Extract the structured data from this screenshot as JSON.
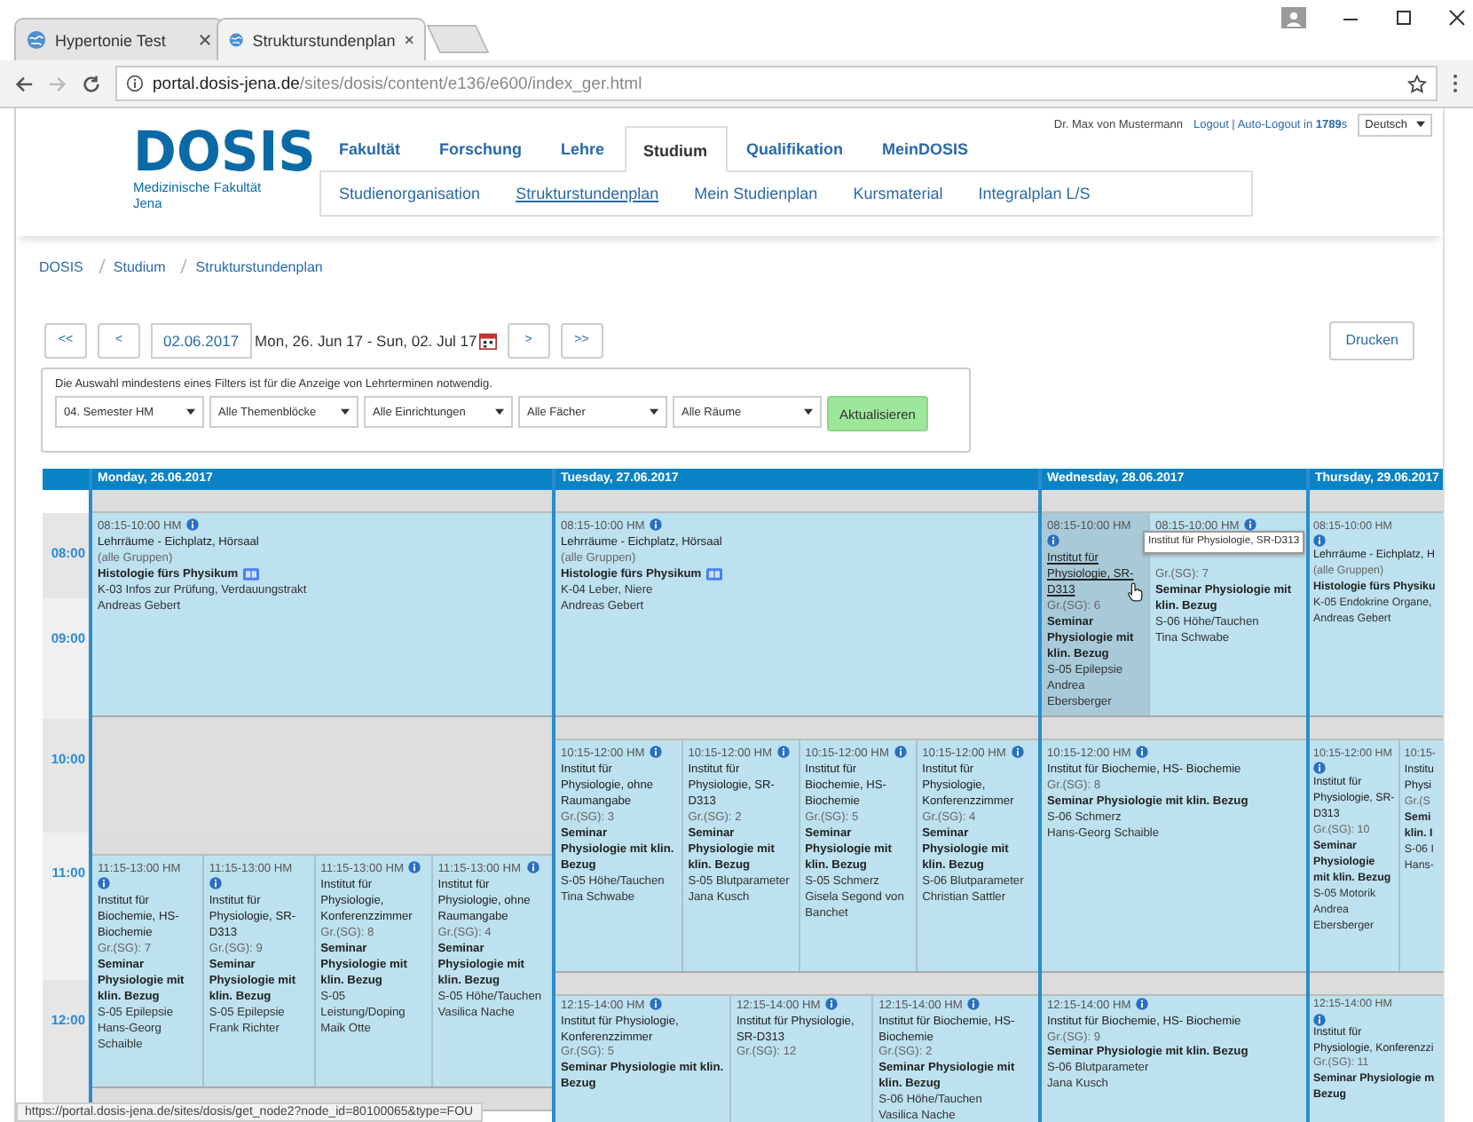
{
  "browser": {
    "tabs": [
      {
        "title": "Hypertonie Test",
        "selected": false
      },
      {
        "title": "Strukturstundenplan",
        "selected": true
      }
    ],
    "address": {
      "domain": "portal.dosis-jena.de",
      "path": "/sites/dosis/content/e136/e600/index_ger.html"
    }
  },
  "site": {
    "logo": "DOSIS",
    "logo_sub": [
      "Medizinische Fakultät",
      "Jena"
    ],
    "nav": [
      {
        "label": "Fakultät",
        "selected": false
      },
      {
        "label": "Forschung",
        "selected": false
      },
      {
        "label": "Lehre",
        "selected": false
      },
      {
        "label": "Studium",
        "selected": true
      },
      {
        "label": "Qualifikation",
        "selected": false
      },
      {
        "label": "MeinDOSIS",
        "selected": false
      }
    ],
    "subnav": [
      {
        "label": "Studienorganisation",
        "selected": false
      },
      {
        "label": "Strukturstundenplan",
        "selected": true
      },
      {
        "label": "Mein Studienplan",
        "selected": false
      },
      {
        "label": "Kursmaterial",
        "selected": false
      },
      {
        "label": "Integralplan L/S",
        "selected": false
      }
    ],
    "user": "Dr. Max von Mustermann",
    "logout": "Logout | Auto-Logout in **1789**s",
    "language": "Deutsch"
  },
  "breadcrumb": [
    "DOSIS",
    "Studium",
    "Strukturstundenplan"
  ],
  "toolbar": {
    "first": "<<",
    "prev": "<",
    "date": "02.06.2017",
    "range": "Mon, 26. Jun 17 - Sun, 02. Jul 17",
    "next": ">",
    "last": ">>",
    "print": "Drucken"
  },
  "filters": {
    "note": "Die Auswahl mindestens eines Filters ist für die Anzeige von Lehrterminen notwendig.",
    "selects": [
      "04. Semester HM",
      "Alle Themenblöcke",
      "Alle Einrichtungen",
      "Alle Fächer",
      "Alle Räume"
    ],
    "submit": "Aktualisieren"
  },
  "hours": [
    "08:00",
    "09:00",
    "10:00",
    "11:00",
    "12:00"
  ],
  "days": [
    {
      "title": "Monday, 26.06.2017",
      "segments": [
        {
          "kind": "strip"
        },
        {
          "kind": "block",
          "events": [
            {
              "time": "08:15-10:00 HM",
              "info": true,
              "hovered": false,
              "lines": [
                {
                  "kind": "room",
                  "text": "Lehrräume - Eichplatz, Hörsaal"
                },
                {
                  "kind": "group",
                  "text": "(alle Gruppen)"
                },
                {
                  "kind": "title",
                  "text": "Histologie fürs Physikum",
                  "book": true
                },
                {
                  "kind": "topic",
                  "text": "K-03 Infos zur Prüfung, Verdauungstrakt"
                },
                {
                  "kind": "lecturer",
                  "text": "Andreas Gebert"
                }
              ]
            }
          ]
        },
        {
          "kind": "free"
        },
        {
          "kind": "strip"
        },
        {
          "kind": "block",
          "events": [
            {
              "time": "11:15-13:00 HM",
              "info": true,
              "hovered": false,
              "lines": [
                {
                  "kind": "room",
                  "text": "Institut für Biochemie, HS-Biochemie"
                },
                {
                  "kind": "group",
                  "text": "Gr.(SG): 7"
                },
                {
                  "kind": "title",
                  "text": "Seminar Physiologie mit klin. Bezug"
                },
                {
                  "kind": "topic",
                  "text": "S-05 Epilepsie"
                },
                {
                  "kind": "lecturer",
                  "text": "Hans-Georg Schaible"
                }
              ]
            },
            {
              "time": "11:15-13:00 HM",
              "info": true,
              "hovered": false,
              "lines": [
                {
                  "kind": "room",
                  "text": "Institut für Physiologie, SR-D313"
                },
                {
                  "kind": "group",
                  "text": "Gr.(SG): 9"
                },
                {
                  "kind": "title",
                  "text": "Seminar Physiologie mit klin. Bezug"
                },
                {
                  "kind": "topic",
                  "text": "S-05 Epilepsie"
                },
                {
                  "kind": "lecturer",
                  "text": "Frank Richter"
                }
              ]
            },
            {
              "time": "11:15-13:00 HM",
              "info": true,
              "hovered": false,
              "lines": [
                {
                  "kind": "room",
                  "text": "Institut für Physiologie, Konferenzzimmer"
                },
                {
                  "kind": "group",
                  "text": "Gr.(SG): 8"
                },
                {
                  "kind": "title",
                  "text": "Seminar Physiologie mit klin. Bezug"
                },
                {
                  "kind": "topic",
                  "text": "S-05 Leistung/Doping"
                },
                {
                  "kind": "lecturer",
                  "text": "Maik Otte"
                }
              ]
            },
            {
              "time": "11:15-13:00 HM",
              "info": true,
              "hovered": false,
              "lines": [
                {
                  "kind": "room",
                  "text": "Institut für Physiologie, ohne Raumangabe"
                },
                {
                  "kind": "group",
                  "text": "Gr.(SG): 4"
                },
                {
                  "kind": "title",
                  "text": "Seminar Physiologie mit klin. Bezug"
                },
                {
                  "kind": "topic",
                  "text": "S-05 Höhe/Tauchen"
                },
                {
                  "kind": "lecturer",
                  "text": "Vasilica Nache"
                }
              ]
            }
          ]
        },
        {
          "kind": "strip"
        }
      ]
    },
    {
      "title": "Tuesday, 27.06.2017",
      "segments": [
        {
          "kind": "strip"
        },
        {
          "kind": "block",
          "events": [
            {
              "time": "08:15-10:00 HM",
              "info": true,
              "hovered": false,
              "lines": [
                {
                  "kind": "room",
                  "text": "Lehrräume - Eichplatz, Hörsaal"
                },
                {
                  "kind": "group",
                  "text": "(alle Gruppen)"
                },
                {
                  "kind": "title",
                  "text": "Histologie fürs Physikum",
                  "book": true
                },
                {
                  "kind": "topic",
                  "text": "K-04 Leber, Niere"
                },
                {
                  "kind": "lecturer",
                  "text": "Andreas Gebert"
                }
              ]
            }
          ]
        },
        {
          "kind": "strip"
        },
        {
          "kind": "block",
          "events": [
            {
              "time": "10:15-12:00 HM",
              "info": true,
              "hovered": false,
              "lines": [
                {
                  "kind": "room",
                  "text": "Institut für Physiologie, ohne Raumangabe"
                },
                {
                  "kind": "group",
                  "text": "Gr.(SG): 3"
                },
                {
                  "kind": "title",
                  "text": "Seminar Physiologie mit klin. Bezug"
                },
                {
                  "kind": "topic",
                  "text": "S-05 Höhe/Tauchen"
                },
                {
                  "kind": "lecturer",
                  "text": "Tina Schwabe"
                }
              ]
            },
            {
              "time": "10:15-12:00 HM",
              "info": true,
              "hovered": false,
              "lines": [
                {
                  "kind": "room",
                  "text": "Institut für Physiologie, SR-D313"
                },
                {
                  "kind": "group",
                  "text": "Gr.(SG): 2"
                },
                {
                  "kind": "title",
                  "text": "Seminar Physiologie mit klin. Bezug"
                },
                {
                  "kind": "topic",
                  "text": "S-05 Blutparameter"
                },
                {
                  "kind": "lecturer",
                  "text": "Jana Kusch"
                }
              ]
            },
            {
              "time": "10:15-12:00 HM",
              "info": true,
              "hovered": false,
              "lines": [
                {
                  "kind": "room",
                  "text": "Institut für Biochemie, HS-Biochemie"
                },
                {
                  "kind": "group",
                  "text": "Gr.(SG): 5"
                },
                {
                  "kind": "title",
                  "text": "Seminar Physiologie mit klin. Bezug"
                },
                {
                  "kind": "topic",
                  "text": "S-05 Schmerz"
                },
                {
                  "kind": "lecturer",
                  "text": "Gisela Segond von Banchet"
                }
              ]
            },
            {
              "time": "10:15-12:00 HM",
              "info": true,
              "hovered": false,
              "lines": [
                {
                  "kind": "room",
                  "text": "Institut für Physiologie, Konferenzzimmer"
                },
                {
                  "kind": "group",
                  "text": "Gr.(SG): 4"
                },
                {
                  "kind": "title",
                  "text": "Seminar Physiologie mit klin. Bezug"
                },
                {
                  "kind": "topic",
                  "text": "S-06 Blutparameter"
                },
                {
                  "kind": "lecturer",
                  "text": "Christian Sattler"
                }
              ]
            }
          ]
        },
        {
          "kind": "strip"
        },
        {
          "kind": "block",
          "events": [
            {
              "time": "12:15-14:00 HM",
              "info": true,
              "hovered": false,
              "lines": [
                {
                  "kind": "room",
                  "text": "Institut für Physiologie, Konferenzzimmer"
                },
                {
                  "kind": "group",
                  "text": "Gr.(SG): 5"
                },
                {
                  "kind": "title",
                  "text": "Seminar Physiologie mit klin. Bezug"
                }
              ]
            },
            {
              "time": "12:15-14:00 HM",
              "info": true,
              "hovered": false,
              "lines": [
                {
                  "kind": "room",
                  "text": "Institut für Physiologie, SR-D313"
                },
                {
                  "kind": "group",
                  "text": "Gr.(SG): 12"
                }
              ]
            },
            {
              "time": "12:15-14:00 HM",
              "info": true,
              "hovered": false,
              "lines": [
                {
                  "kind": "room",
                  "text": "Institut für Biochemie, HS- Biochemie"
                },
                {
                  "kind": "group",
                  "text": "Gr.(SG): 2"
                },
                {
                  "kind": "title",
                  "text": "Seminar Physiologie mit klin. Bezug"
                },
                {
                  "kind": "topic",
                  "text": "S-06 Höhe/Tauchen"
                },
                {
                  "kind": "lecturer",
                  "text": "Vasilica Nache"
                }
              ]
            }
          ]
        }
      ]
    },
    {
      "title": "Wednesday, 28.06.2017",
      "segments": [
        {
          "kind": "strip"
        },
        {
          "kind": "block",
          "events": [
            {
              "time": "08:15-10:00 HM",
              "info": true,
              "hovered": true,
              "tooltip": "Institut für Physiologie, SR-D313",
              "lines": [
                {
                  "kind": "room",
                  "text": "Institut für Physiologie, SR-D313"
                },
                {
                  "kind": "group",
                  "text": "Gr.(SG): 6"
                },
                {
                  "kind": "title",
                  "text": "Seminar Physiologie mit klin. Bezug"
                },
                {
                  "kind": "topic",
                  "text": "S-05 Epilepsie"
                },
                {
                  "kind": "lecturer",
                  "text": "Andrea Ebersberger"
                }
              ]
            },
            {
              "time": "08:15-10:00 HM",
              "info": true,
              "hovered": false,
              "lines": [
                {
                  "kind": "group",
                  "text": "Gr.(SG): 7"
                },
                {
                  "kind": "title",
                  "text": "Seminar Physiologie mit klin. Bezug"
                },
                {
                  "kind": "topic",
                  "text": "S-06 Höhe/Tauchen"
                },
                {
                  "kind": "lecturer",
                  "text": "Tina Schwabe"
                }
              ]
            }
          ]
        },
        {
          "kind": "strip"
        },
        {
          "kind": "block",
          "events": [
            {
              "time": "10:15-12:00 HM",
              "info": true,
              "hovered": false,
              "lines": [
                {
                  "kind": "room",
                  "text": "Institut für Biochemie, HS- Biochemie"
                },
                {
                  "kind": "group",
                  "text": "Gr.(SG): 8"
                },
                {
                  "kind": "title",
                  "text": "Seminar Physiologie mit klin. Bezug"
                },
                {
                  "kind": "topic",
                  "text": "S-06 Schmerz"
                },
                {
                  "kind": "lecturer",
                  "text": "Hans-Georg Schaible"
                }
              ]
            }
          ]
        },
        {
          "kind": "strip"
        },
        {
          "kind": "block",
          "events": [
            {
              "time": "12:15-14:00 HM",
              "info": true,
              "hovered": false,
              "lines": [
                {
                  "kind": "room",
                  "text": "Institut für Biochemie, HS- Biochemie"
                },
                {
                  "kind": "group",
                  "text": "Gr.(SG): 9"
                },
                {
                  "kind": "title",
                  "text": "Seminar Physiologie mit klin. Bezug"
                },
                {
                  "kind": "topic",
                  "text": "S-06 Blutparameter"
                },
                {
                  "kind": "lecturer",
                  "text": "Jana Kusch"
                }
              ]
            }
          ]
        }
      ]
    },
    {
      "title": "Thursday, 29.06.2017",
      "segments": [
        {
          "kind": "strip"
        },
        {
          "kind": "block",
          "events": [
            {
              "time": "08:15-10:00 HM",
              "info": true,
              "hovered": false,
              "lines": [
                {
                  "kind": "room",
                  "text": "Lehrräume - Eichplatz, H"
                },
                {
                  "kind": "group",
                  "text": "(alle Gruppen)"
                },
                {
                  "kind": "title",
                  "text": "Histologie fürs Physiku"
                },
                {
                  "kind": "topic",
                  "text": "K-05 Endokrine Organe,"
                },
                {
                  "kind": "lecturer",
                  "text": "Andreas Gebert"
                }
              ]
            }
          ]
        },
        {
          "kind": "strip"
        },
        {
          "kind": "block",
          "events": [
            {
              "time": "10:15-12:00 HM",
              "info": true,
              "hovered": false,
              "lines": [
                {
                  "kind": "room",
                  "text": "Institut für"
                },
                {
                  "kind": "room",
                  "text": "Physiologie, SR-"
                },
                {
                  "kind": "room",
                  "text": "D313"
                },
                {
                  "kind": "group",
                  "text": "Gr.(SG): 10"
                },
                {
                  "kind": "title",
                  "text": "Seminar"
                },
                {
                  "kind": "title",
                  "text": "Physiologie"
                },
                {
                  "kind": "title",
                  "text": "mit klin. Bezug"
                },
                {
                  "kind": "topic",
                  "text": "S-05 Motorik"
                },
                {
                  "kind": "lecturer",
                  "text": "Andrea"
                },
                {
                  "kind": "lecturer",
                  "text": "Ebersberger"
                }
              ]
            },
            {
              "time": "10:15-",
              "info": false,
              "hovered": false,
              "lines": [
                {
                  "kind": "room",
                  "text": "Institu"
                },
                {
                  "kind": "room",
                  "text": "Physi"
                },
                {
                  "kind": "group",
                  "text": "Gr.(S"
                },
                {
                  "kind": "title",
                  "text": "Semi"
                },
                {
                  "kind": "title",
                  "text": "klin. I"
                },
                {
                  "kind": "topic",
                  "text": "S-06 I"
                },
                {
                  "kind": "lecturer",
                  "text": "Hans-"
                }
              ]
            }
          ]
        },
        {
          "kind": "strip"
        },
        {
          "kind": "block",
          "events": [
            {
              "time": "12:15-14:00 HM",
              "info": true,
              "hovered": false,
              "lines": [
                {
                  "kind": "room",
                  "text": "Institut für"
                },
                {
                  "kind": "room",
                  "text": "Physiologie, Konferenzzi"
                },
                {
                  "kind": "group",
                  "text": "Gr.(SG): 11"
                },
                {
                  "kind": "title",
                  "text": "Seminar Physiologie m"
                },
                {
                  "kind": "title",
                  "text": "Bezug"
                }
              ]
            }
          ]
        }
      ]
    }
  ],
  "status_url": "https://portal.dosis-jena.de/sites/dosis/get_node2?node_id=80100065&type=FOU"
}
